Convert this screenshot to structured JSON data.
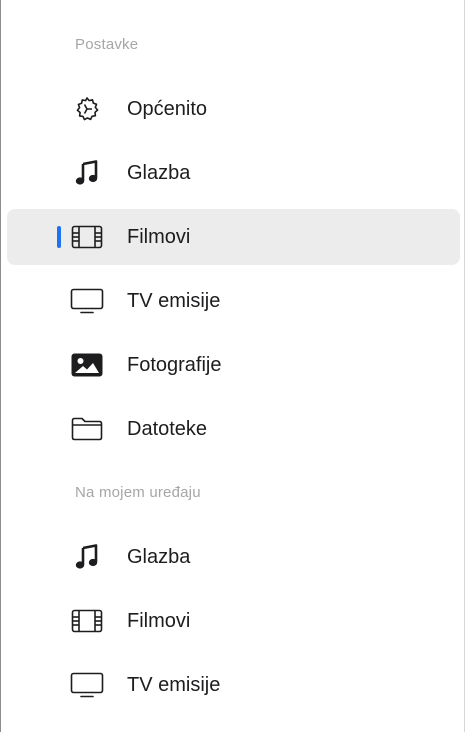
{
  "sidebar": {
    "settings_header": "Postavke",
    "settings_items": [
      {
        "label": "Općenito",
        "icon": "gear-icon"
      },
      {
        "label": "Glazba",
        "icon": "music-note-icon"
      },
      {
        "label": "Filmovi",
        "icon": "film-icon",
        "selected": true
      },
      {
        "label": "TV emisije",
        "icon": "tv-icon"
      },
      {
        "label": "Fotografije",
        "icon": "photo-icon"
      },
      {
        "label": "Datoteke",
        "icon": "folder-icon"
      }
    ],
    "device_header": "Na mojem uređaju",
    "device_items": [
      {
        "label": "Glazba",
        "icon": "music-note-icon"
      },
      {
        "label": "Filmovi",
        "icon": "film-icon"
      },
      {
        "label": "TV emisije",
        "icon": "tv-icon"
      }
    ]
  },
  "colors": {
    "selection_background": "#ececec",
    "selection_marker": "#1f73f0",
    "section_header_text": "#a6a6a6",
    "item_text": "#1d1d1f"
  }
}
